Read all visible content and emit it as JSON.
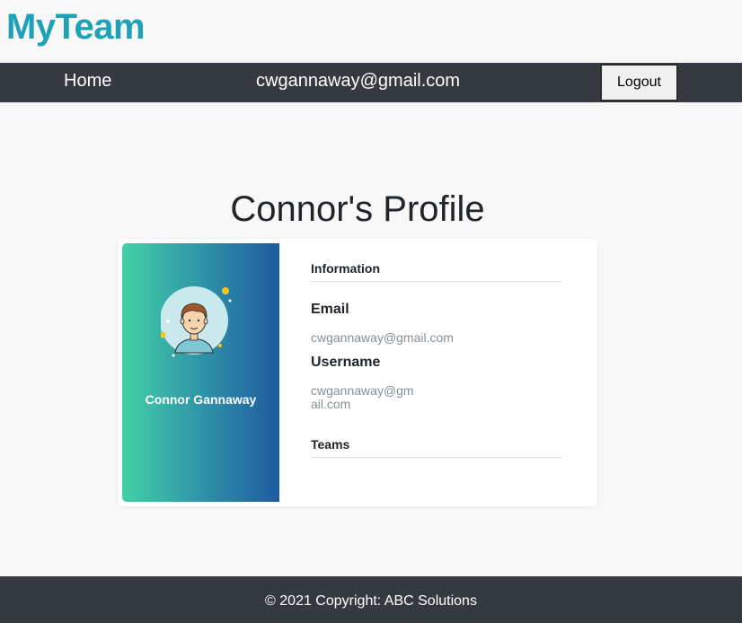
{
  "brand": {
    "title": "MyTeam"
  },
  "nav": {
    "home_label": "Home",
    "user_email": "cwgannaway@gmail.com",
    "logout_label": "Logout"
  },
  "profile": {
    "page_title": "Connor's Profile",
    "name": "Connor Gannaway",
    "information_heading": "Information",
    "email_label": "Email",
    "email_value": "cwgannaway@gmail.com",
    "username_label": "Username",
    "username_line1": "cwgannaway@gm",
    "username_line2": "ail.com",
    "teams_heading": "Teams"
  },
  "footer": {
    "text": "© 2021 Copyright: ABC Solutions"
  },
  "colors": {
    "brand": "#1fa2b8",
    "navbar": "#343a40",
    "gradient_start": "#43d1a6",
    "gradient_end": "#1e5aa0"
  }
}
